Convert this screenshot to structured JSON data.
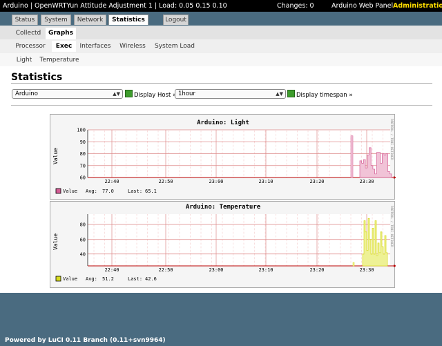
{
  "topbar": {
    "title": "Arduino | OpenWRTYun Attitude Adjustment 1 | Load: 0.05 0.15 0.10",
    "changes": "Changes: 0",
    "panel": "Arduino Web Panel",
    "admin": "Administration"
  },
  "main_tabs": [
    "Status",
    "System",
    "Network",
    "Statistics",
    "Logout"
  ],
  "sub_tabs": [
    "Collectd",
    "Graphs"
  ],
  "plugin_tabs": [
    "Processor",
    "Exec",
    "Interfaces",
    "Wireless",
    "System Load"
  ],
  "instance_tabs": [
    "Light",
    "Temperature"
  ],
  "page_title": "Statistics",
  "host_select": "Arduino",
  "host_button": "Display Host »",
  "timespan_select": "1hour",
  "timespan_button": "Display timespan »",
  "graphs": [
    {
      "title": "Arduino: Light",
      "ylabel": "Value",
      "side_label": "RRDTOOL / TOBI OETIKER",
      "x_ticks": [
        "22:40",
        "22:50",
        "23:00",
        "23:10",
        "23:20",
        "23:30"
      ],
      "y_ticks": [
        "100",
        "90",
        "80",
        "70",
        "60"
      ],
      "legend_label": "Value",
      "avg_label": "Avg:",
      "avg": "77.0",
      "last_label": "Last:",
      "last": "65.1",
      "color": "#d45d95"
    },
    {
      "title": "Arduino: Temperature",
      "ylabel": "Value",
      "side_label": "RRDTOOL / TOBI OETIKER",
      "x_ticks": [
        "22:40",
        "22:50",
        "23:00",
        "23:10",
        "23:20",
        "23:30"
      ],
      "y_ticks": [
        "80",
        "60",
        "40"
      ],
      "legend_label": "Value",
      "avg_label": "Avg:",
      "avg": "51.2",
      "last_label": "Last:",
      "last": "42.6",
      "color": "#d7db20"
    }
  ],
  "footer": "Powered by LuCI 0.11 Branch (0.11+svn9964)"
}
